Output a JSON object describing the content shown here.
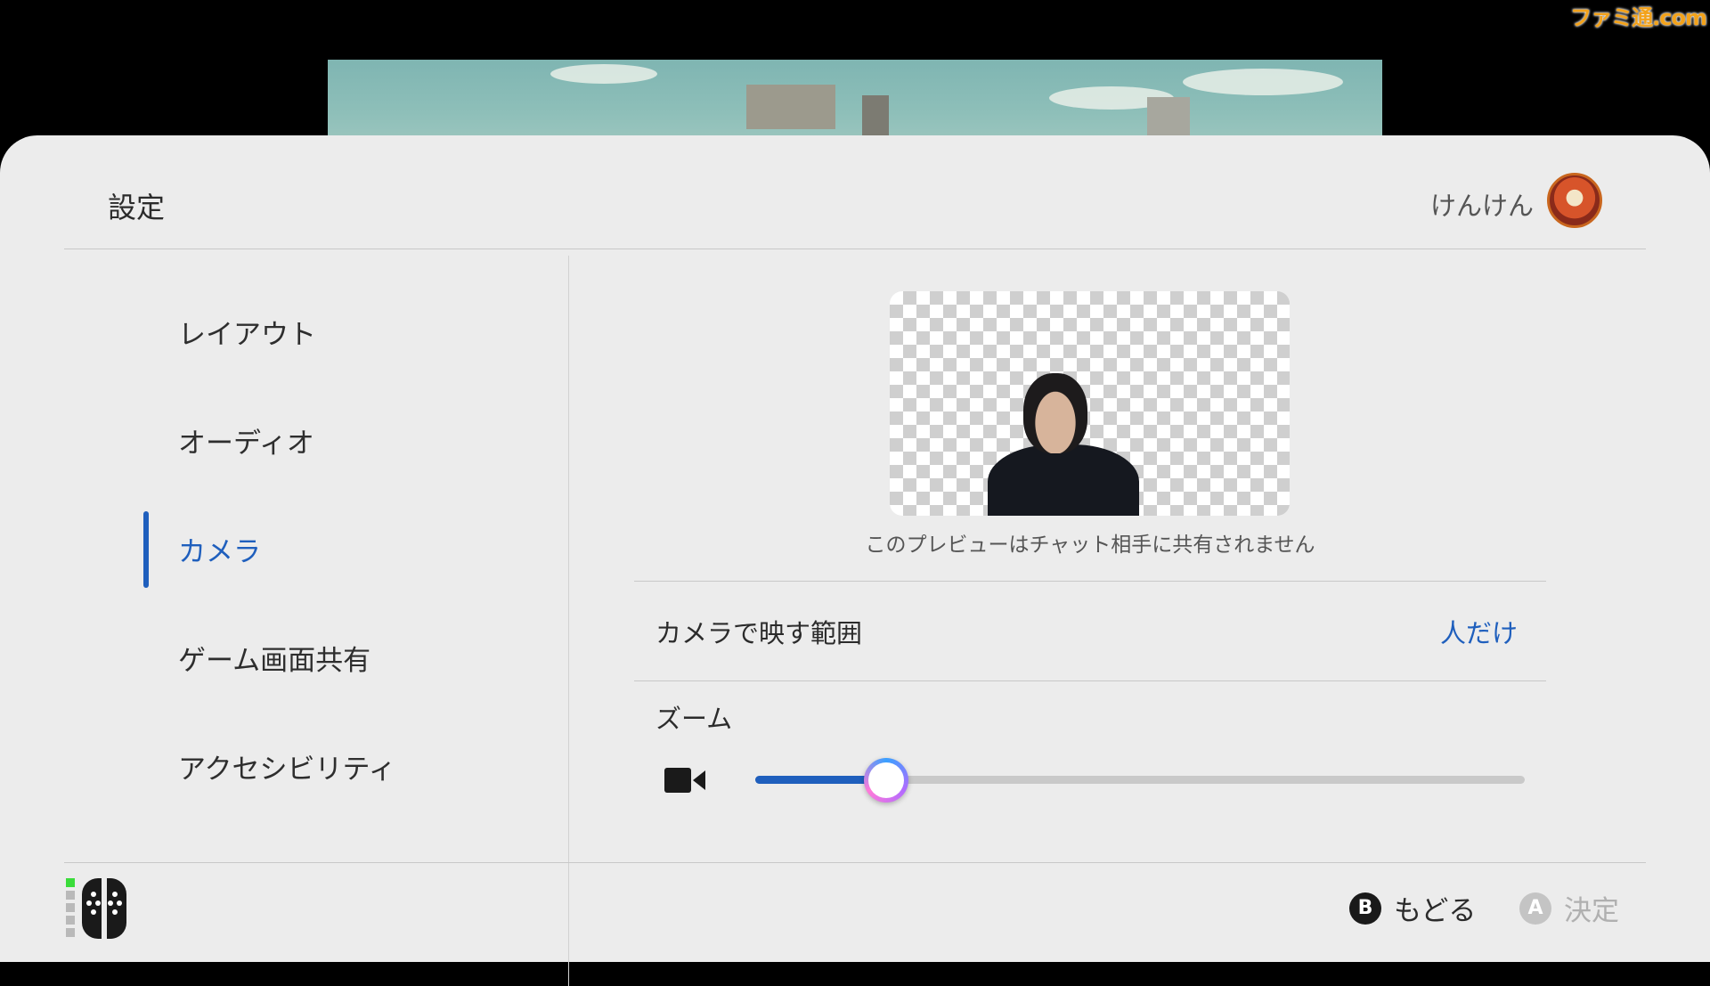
{
  "watermark": "ファミ通.com",
  "header": {
    "title": "設定",
    "user_name": "けんけん"
  },
  "sidebar": {
    "items": [
      {
        "label": "レイアウト",
        "active": false
      },
      {
        "label": "オーディオ",
        "active": false
      },
      {
        "label": "カメラ",
        "active": true
      },
      {
        "label": "ゲーム画面共有",
        "active": false
      },
      {
        "label": "アクセシビリティ",
        "active": false
      }
    ]
  },
  "camera": {
    "preview_caption": "このプレビューはチャット相手に共有されません",
    "range_label": "カメラで映す範囲",
    "range_value": "人だけ",
    "zoom_label": "ズーム",
    "zoom_level": 0.17
  },
  "footer": {
    "back_key": "B",
    "back_label": "もどる",
    "confirm_key": "A",
    "confirm_label": "決定"
  },
  "colors": {
    "accent": "#1f5fbd",
    "panel": "#ececec",
    "disabled": "#b0b0b0"
  }
}
